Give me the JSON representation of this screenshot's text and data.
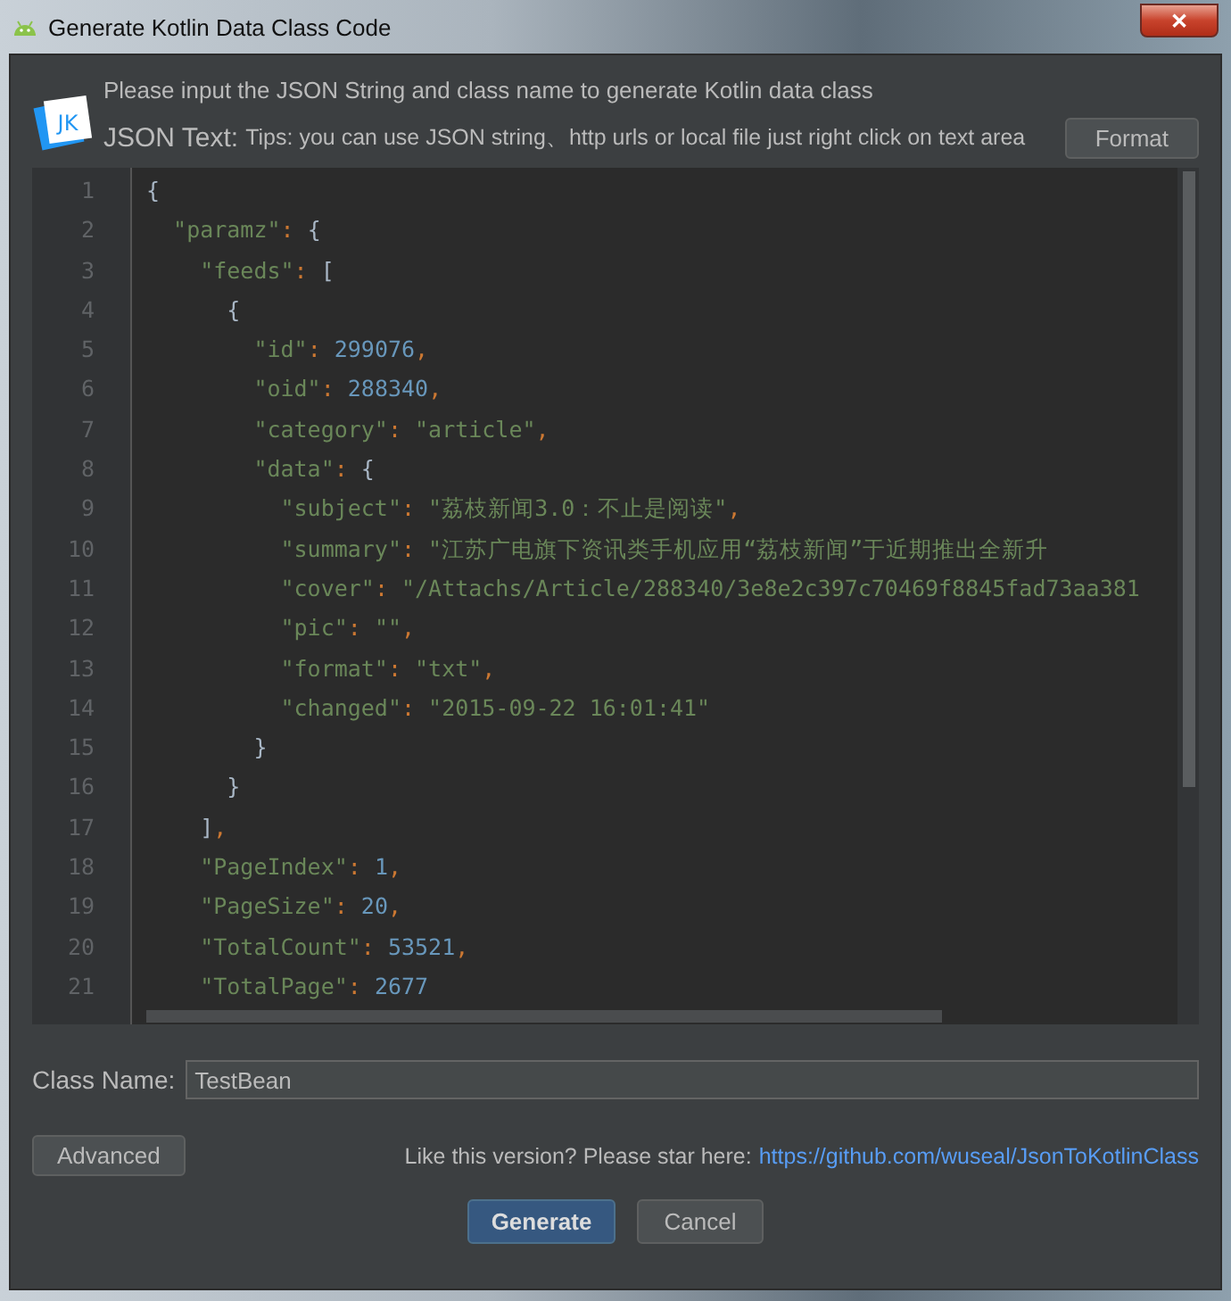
{
  "window": {
    "title": "Generate Kotlin Data Class Code",
    "close_label": "✕"
  },
  "header": {
    "logo_text": "JK",
    "description": "Please input the JSON String and class name to generate Kotlin data class",
    "json_label": "JSON Text:",
    "tips": "Tips: you can use JSON string、http urls or local file just right click on text area",
    "format_button": "Format"
  },
  "editor": {
    "lines": [
      {
        "number": "1",
        "tokens": [
          {
            "kind": "brace",
            "text": "{"
          }
        ]
      },
      {
        "number": "2",
        "tokens": [
          {
            "kind": "key",
            "text": "\"paramz\""
          },
          {
            "kind": "sep",
            "text": ": "
          },
          {
            "kind": "brace",
            "text": "{"
          }
        ]
      },
      {
        "number": "3",
        "tokens": [
          {
            "kind": "key",
            "text": "\"feeds\""
          },
          {
            "kind": "sep",
            "text": ": "
          },
          {
            "kind": "brace",
            "text": "["
          }
        ]
      },
      {
        "number": "4",
        "tokens": [
          {
            "kind": "brace",
            "text": "{"
          }
        ]
      },
      {
        "number": "5",
        "tokens": [
          {
            "kind": "key",
            "text": "\"id\""
          },
          {
            "kind": "sep",
            "text": ": "
          },
          {
            "kind": "number",
            "text": "299076"
          },
          {
            "kind": "sep",
            "text": ","
          }
        ]
      },
      {
        "number": "6",
        "tokens": [
          {
            "kind": "key",
            "text": "\"oid\""
          },
          {
            "kind": "sep",
            "text": ": "
          },
          {
            "kind": "number",
            "text": "288340"
          },
          {
            "kind": "sep",
            "text": ","
          }
        ]
      },
      {
        "number": "7",
        "tokens": [
          {
            "kind": "key",
            "text": "\"category\""
          },
          {
            "kind": "sep",
            "text": ": "
          },
          {
            "kind": "string",
            "text": "\"article\""
          },
          {
            "kind": "sep",
            "text": ","
          }
        ]
      },
      {
        "number": "8",
        "tokens": [
          {
            "kind": "key",
            "text": "\"data\""
          },
          {
            "kind": "sep",
            "text": ": "
          },
          {
            "kind": "brace",
            "text": "{"
          }
        ]
      },
      {
        "number": "9",
        "tokens": [
          {
            "kind": "key",
            "text": "\"subject\""
          },
          {
            "kind": "sep",
            "text": ": "
          },
          {
            "kind": "string",
            "text": "\"荔枝新闻3.0：不止是阅读\""
          },
          {
            "kind": "sep",
            "text": ","
          }
        ]
      },
      {
        "number": "10",
        "tokens": [
          {
            "kind": "key",
            "text": "\"summary\""
          },
          {
            "kind": "sep",
            "text": ": "
          },
          {
            "kind": "string",
            "text": "\"江苏广电旗下资讯类手机应用“荔枝新闻”于近期推出全新升"
          }
        ]
      },
      {
        "number": "11",
        "tokens": [
          {
            "kind": "key",
            "text": "\"cover\""
          },
          {
            "kind": "sep",
            "text": ": "
          },
          {
            "kind": "string",
            "text": "\"/Attachs/Article/288340/3e8e2c397c70469f8845fad73aa381"
          }
        ]
      },
      {
        "number": "12",
        "tokens": [
          {
            "kind": "key",
            "text": "\"pic\""
          },
          {
            "kind": "sep",
            "text": ": "
          },
          {
            "kind": "string",
            "text": "\"\""
          },
          {
            "kind": "sep",
            "text": ","
          }
        ]
      },
      {
        "number": "13",
        "tokens": [
          {
            "kind": "key",
            "text": "\"format\""
          },
          {
            "kind": "sep",
            "text": ": "
          },
          {
            "kind": "string",
            "text": "\"txt\""
          },
          {
            "kind": "sep",
            "text": ","
          }
        ]
      },
      {
        "number": "14",
        "tokens": [
          {
            "kind": "key",
            "text": "\"changed\""
          },
          {
            "kind": "sep",
            "text": ": "
          },
          {
            "kind": "string",
            "text": "\"2015-09-22 16:01:41\""
          }
        ]
      },
      {
        "number": "15",
        "tokens": [
          {
            "kind": "brace",
            "text": "}"
          }
        ]
      },
      {
        "number": "16",
        "tokens": [
          {
            "kind": "brace",
            "text": "}"
          }
        ]
      },
      {
        "number": "17",
        "tokens": [
          {
            "kind": "brace",
            "text": "]"
          },
          {
            "kind": "sep",
            "text": ","
          }
        ]
      },
      {
        "number": "18",
        "tokens": [
          {
            "kind": "key",
            "text": "\"PageIndex\""
          },
          {
            "kind": "sep",
            "text": ": "
          },
          {
            "kind": "number",
            "text": "1"
          },
          {
            "kind": "sep",
            "text": ","
          }
        ]
      },
      {
        "number": "19",
        "tokens": [
          {
            "kind": "key",
            "text": "\"PageSize\""
          },
          {
            "kind": "sep",
            "text": ": "
          },
          {
            "kind": "number",
            "text": "20"
          },
          {
            "kind": "sep",
            "text": ","
          }
        ]
      },
      {
        "number": "20",
        "tokens": [
          {
            "kind": "key",
            "text": "\"TotalCount\""
          },
          {
            "kind": "sep",
            "text": ": "
          },
          {
            "kind": "number",
            "text": "53521"
          },
          {
            "kind": "sep",
            "text": ","
          }
        ]
      },
      {
        "number": "21",
        "tokens": [
          {
            "kind": "key",
            "text": "\"TotalPage\""
          },
          {
            "kind": "sep",
            "text": ": "
          },
          {
            "kind": "number",
            "text": "2677"
          }
        ]
      }
    ]
  },
  "class_name": {
    "label": "Class Name:",
    "value": "TestBean"
  },
  "footer": {
    "advanced_button": "Advanced",
    "star_text": "Like this version? Please star here:",
    "link": "https://github.com/wuseal/JsonToKotlinClass"
  },
  "buttons": [
    {
      "label": "Generate",
      "kind": "primary"
    },
    {
      "label": "Cancel",
      "kind": "normal"
    }
  ]
}
